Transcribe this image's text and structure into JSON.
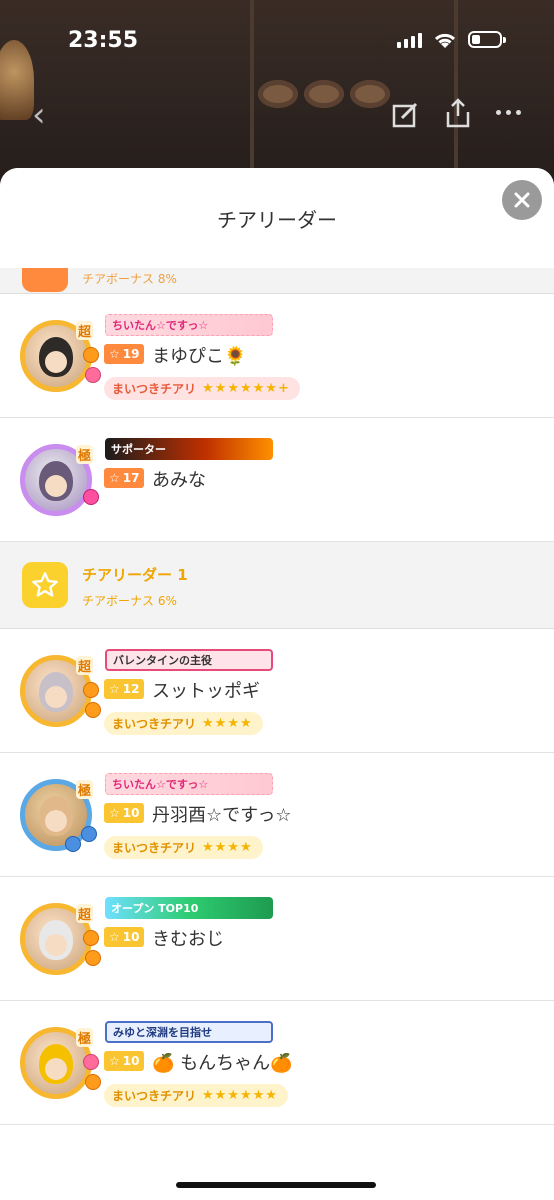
{
  "status_bar": {
    "time": "23:55"
  },
  "sheet": {
    "title": "チアリーダー",
    "close_icon": "close-icon"
  },
  "sections": [
    {
      "name": "",
      "bonus": "チアボーナス 8%",
      "icon": "star-icon",
      "members": [
        {
          "banner": "ちいたん☆ですっ☆",
          "banner_style": "pink",
          "level": "19",
          "badge_style": "orange",
          "name": "まゆぴこ🌻",
          "chip": "まいつきチアリ",
          "chip_style": "pink",
          "stars": "★★★★★★+",
          "avatar_style": "gold",
          "rank": "超"
        },
        {
          "banner": "サポーター",
          "banner_style": "fire",
          "level": "17",
          "badge_style": "orange",
          "name": "あみな",
          "chip": "",
          "chip_style": "",
          "stars": "",
          "avatar_style": "rainbow",
          "rank": "極"
        }
      ]
    },
    {
      "name": "チアリーダー 1",
      "bonus": "チアボーナス 6%",
      "icon": "star-icon",
      "members": [
        {
          "banner": "バレンタインの主役",
          "banner_style": "valentine",
          "level": "12",
          "badge_style": "yellow",
          "name": "スットッポギ",
          "chip": "まいつきチアリ",
          "chip_style": "yellow",
          "stars": "★★★★",
          "avatar_style": "gold",
          "rank": "超"
        },
        {
          "banner": "ちいたん☆ですっ☆",
          "banner_style": "pink",
          "level": "10",
          "badge_style": "yellow",
          "name": "丹羽酉☆ですっ☆",
          "chip": "まいつきチアリ",
          "chip_style": "yellow",
          "stars": "★★★★",
          "avatar_style": "blue",
          "rank": "極"
        },
        {
          "banner": "オープン TOP10",
          "banner_style": "green",
          "level": "10",
          "badge_style": "yellow",
          "name": "きむおじ",
          "chip": "",
          "chip_style": "",
          "stars": "",
          "avatar_style": "gold",
          "rank": "超"
        },
        {
          "banner": "みゆと深淵を目指せ",
          "banner_style": "blue",
          "level": "10",
          "badge_style": "yellow",
          "name": "🍊 もんちゃん🍊",
          "chip": "まいつきチアリ",
          "chip_style": "yellow",
          "stars": "★★★★★★",
          "avatar_style": "gold",
          "rank": "極"
        }
      ]
    }
  ]
}
